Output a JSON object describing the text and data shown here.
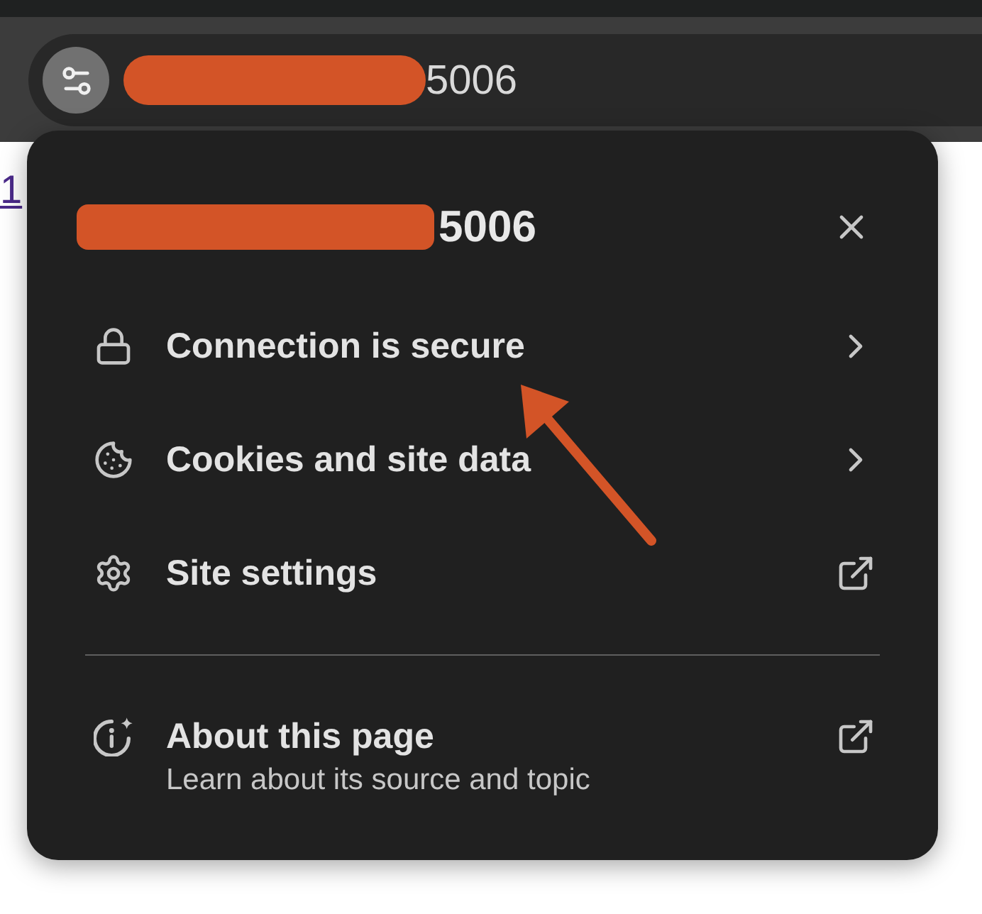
{
  "browser": {
    "address_bar": {
      "url_text": "5006"
    }
  },
  "page": {
    "link_text": "1"
  },
  "site_info": {
    "title": "5006",
    "items": [
      {
        "label": "Connection is secure",
        "kind": "submenu"
      },
      {
        "label": "Cookies and site data",
        "kind": "submenu"
      },
      {
        "label": "Site settings",
        "kind": "external"
      }
    ],
    "about": {
      "title": "About this page",
      "description": "Learn about its source and topic",
      "kind": "external"
    }
  }
}
